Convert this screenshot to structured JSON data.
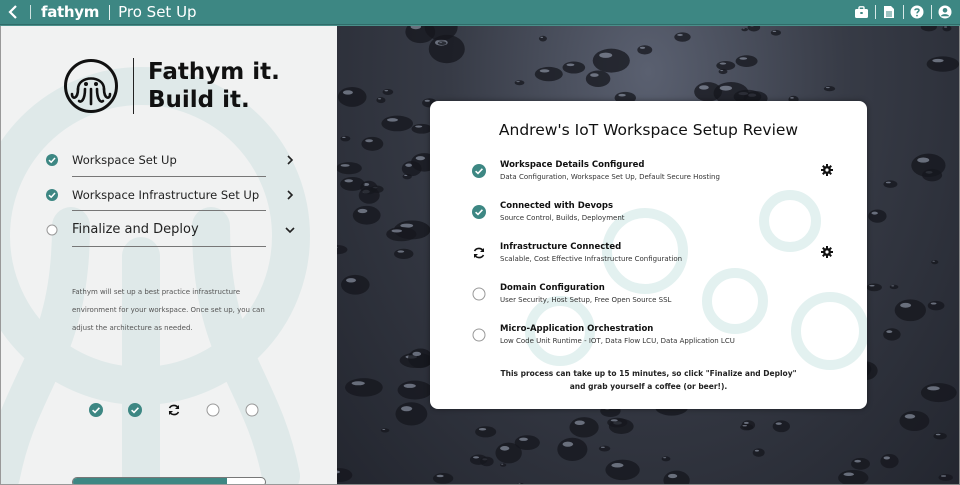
{
  "app": {
    "brand": "fathym",
    "section_title": "Pro Set Up",
    "icons": [
      "back-icon",
      "briefcase-icon",
      "document-icon",
      "help-icon",
      "user-icon"
    ],
    "accent": "#3d8783"
  },
  "left": {
    "logo_line1": "Fathym it.",
    "logo_line2": "Build it.",
    "steps": [
      {
        "label": "Workspace Set Up",
        "status": "done"
      },
      {
        "label": "Workspace Infrastructure Set Up",
        "status": "done"
      },
      {
        "label": "Finalize and Deploy",
        "status": "current"
      }
    ],
    "description": "Fathym will set up a best practice infrastructure environment for your workspace. Once set up, you can adjust the architecture as needed.",
    "progress_fraction": 0.8,
    "dot_states": [
      "done",
      "done",
      "in-progress",
      "pending",
      "pending"
    ]
  },
  "card": {
    "title": "Andrew's IoT Workspace Setup Review",
    "items": [
      {
        "title": "Workspace Details Configured",
        "sub": "Data Configuration, Workspace Set Up, Default Secure Hosting",
        "status": "done",
        "gear": true
      },
      {
        "title": "Connected with Devops",
        "sub": "Source Control, Builds, Deployment",
        "status": "done",
        "gear": false
      },
      {
        "title": "Infrastructure Connected",
        "sub": "Scalable, Cost Effective Infrastructure Configuration",
        "status": "in-progress",
        "gear": true
      },
      {
        "title": "Domain Configuration",
        "sub": "User Security, Host Setup, Free Open Source SSL",
        "status": "pending",
        "gear": false
      },
      {
        "title": "Micro-Application Orchestration",
        "sub": "Low Code Unit Runtime - IOT, Data Flow LCU, Data Application LCU",
        "status": "pending",
        "gear": false
      }
    ],
    "note_line1": "This process can take up to 15 minutes, so click \"Finalize and Deploy\"",
    "note_line2": "and grab yourself a coffee (or beer!)."
  }
}
